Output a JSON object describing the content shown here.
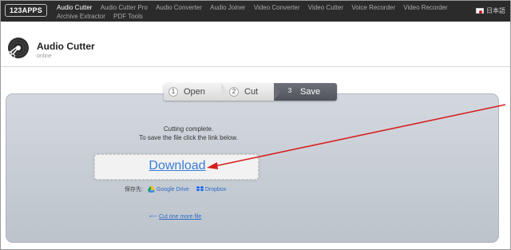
{
  "brand": {
    "logo": "123APPS"
  },
  "nav": {
    "items": [
      {
        "label": "Audio Cutter",
        "active": true
      },
      {
        "label": "Audio Cutter Pro",
        "active": false
      },
      {
        "label": "Audio Converter",
        "active": false
      },
      {
        "label": "Audio Joiner",
        "active": false
      },
      {
        "label": "Video Converter",
        "active": false
      },
      {
        "label": "Video Cutter",
        "active": false
      },
      {
        "label": "Voice Recorder",
        "active": false
      },
      {
        "label": "Video Recorder",
        "active": false
      },
      {
        "label": "Archive Extractor",
        "active": false
      },
      {
        "label": "PDF Tools",
        "active": false
      }
    ],
    "language": "日本語"
  },
  "header": {
    "title": "Audio Cutter",
    "subtitle": "online"
  },
  "steps": [
    {
      "num": "1",
      "label": "Open"
    },
    {
      "num": "2",
      "label": "Cut"
    },
    {
      "num": "3",
      "label": "Save"
    }
  ],
  "main": {
    "message_line1": "Cutting complete.",
    "message_line2": "To save the file click the link below.",
    "download_label": "Download",
    "save_to_label": "保存先:",
    "google_drive_label": "Google Drive",
    "dropbox_label": "Dropbox",
    "back_arrow": "⟵",
    "back_label": "Cut one more file"
  },
  "colors": {
    "link": "#2a6cc5",
    "annotation_arrow": "#d81f1f",
    "nav_bg": "#2b2b2b"
  }
}
